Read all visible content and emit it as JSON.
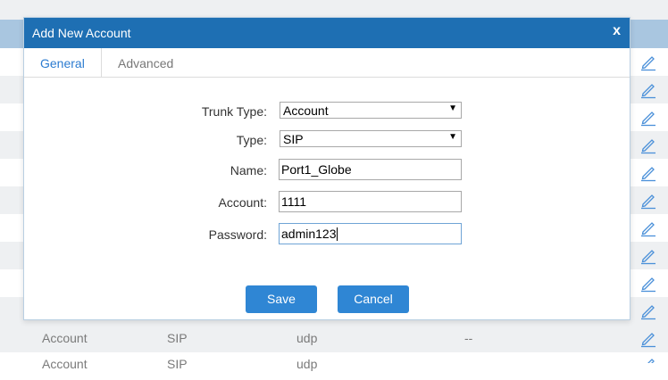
{
  "dialog": {
    "title": "Add New Account",
    "close_label": "x",
    "tabs": [
      {
        "label": "General",
        "active": true
      },
      {
        "label": "Advanced",
        "active": false
      }
    ],
    "fields": {
      "trunk_type": {
        "label": "Trunk Type:",
        "value": "Account"
      },
      "type": {
        "label": "Type:",
        "value": "SIP"
      },
      "name": {
        "label": "Name:",
        "value": "Port1_Globe"
      },
      "account": {
        "label": "Account:",
        "value": "1111"
      },
      "password": {
        "label": "Password:",
        "value": "admin123"
      }
    },
    "buttons": {
      "save": "Save",
      "cancel": "Cancel"
    }
  },
  "background_table": {
    "rows": [
      {
        "type": "Account",
        "protocol": "SIP",
        "transport": "udp",
        "extra": "--"
      },
      {
        "type": "Account",
        "protocol": "SIP",
        "transport": "udp",
        "extra": ""
      }
    ]
  },
  "colors": {
    "header_blue": "#1e6fb3",
    "button_blue": "#2f86d4",
    "tab_active_text": "#2b7bd0"
  },
  "icons": {
    "edit": "pencil-icon"
  }
}
